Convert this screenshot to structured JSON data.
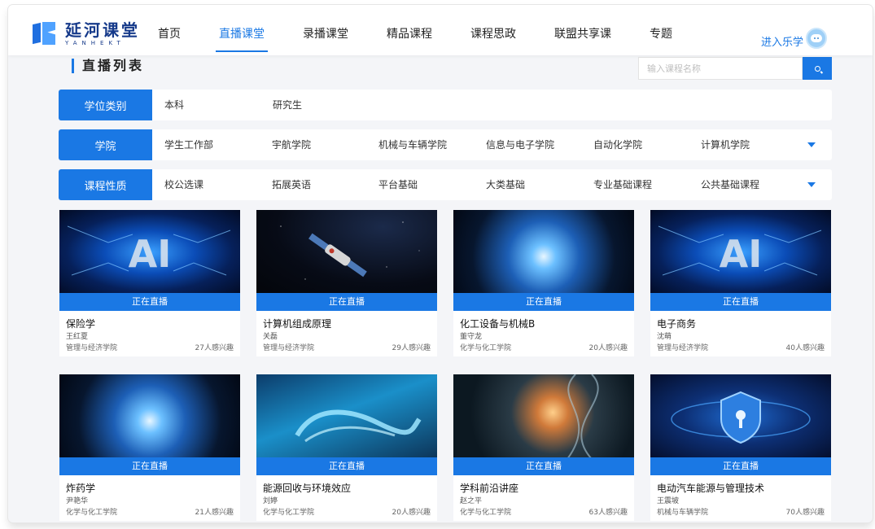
{
  "brand": {
    "name": "延河课堂",
    "subtitle": "YANHEKT"
  },
  "nav": {
    "items": [
      "首页",
      "直播课堂",
      "录播课堂",
      "精品课程",
      "课程思政",
      "联盟共享课",
      "专题"
    ],
    "active_index": 1,
    "enter_label": "进入乐学"
  },
  "page_title": "直播列表",
  "search": {
    "placeholder": "输入课程名称"
  },
  "filters": [
    {
      "label": "学位类别",
      "options": [
        "本科",
        "研究生"
      ]
    },
    {
      "label": "学院",
      "options": [
        "学生工作部",
        "宇航学院",
        "机械与车辆学院",
        "信息与电子学院",
        "自动化学院",
        "计算机学院"
      ]
    },
    {
      "label": "课程性质",
      "options": [
        "校公选课",
        "拓展英语",
        "平台基础",
        "大类基础",
        "专业基础课程",
        "公共基础课程"
      ]
    }
  ],
  "live_label": "正在直播",
  "courses": [
    {
      "title": "保险学",
      "teacher": "王红夏",
      "college": "管理与经济学院",
      "interest": "27人感兴趣",
      "thumb": "ai-chip"
    },
    {
      "title": "计算机组成原理",
      "teacher": "关磊",
      "college": "管理与经济学院",
      "interest": "29人感兴趣",
      "thumb": "space-station"
    },
    {
      "title": "化工设备与机械B",
      "teacher": "董守龙",
      "college": "化学与化工学院",
      "interest": "20人感兴趣",
      "thumb": "particle-burst"
    },
    {
      "title": "电子商务",
      "teacher": "沈萌",
      "college": "管理与经济学院",
      "interest": "40人感兴趣",
      "thumb": "ai-chip"
    },
    {
      "title": "炸药学",
      "teacher": "尹艳华",
      "college": "化学与化工学院",
      "interest": "21人感兴趣",
      "thumb": "particle-burst"
    },
    {
      "title": "能源回收与环境效应",
      "teacher": "刘婷",
      "college": "化学与化工学院",
      "interest": "20人感兴趣",
      "thumb": "neon-text"
    },
    {
      "title": "学科前沿讲座",
      "teacher": "赵之平",
      "college": "化学与化工学院",
      "interest": "63人感兴趣",
      "thumb": "dna-helix"
    },
    {
      "title": "电动汽车能源与管理技术",
      "teacher": "王震坡",
      "college": "机械与车辆学院",
      "interest": "70人感兴趣",
      "thumb": "security-lock"
    }
  ],
  "colors": {
    "accent": "#1a78e4",
    "background": "#f4f5f8",
    "brand": "#163a8a"
  }
}
